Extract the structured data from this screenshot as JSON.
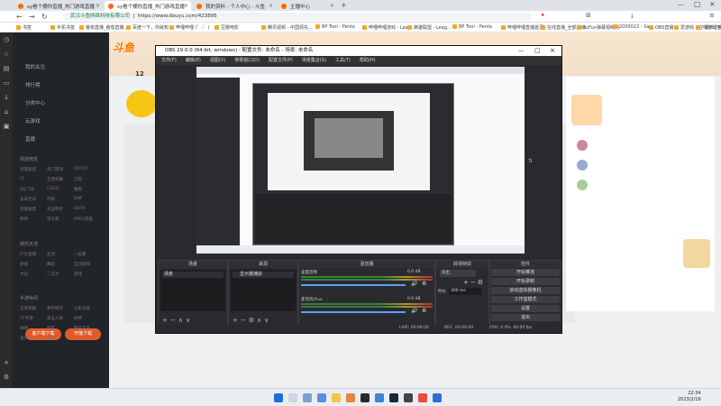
{
  "browser": {
    "tabs": [
      {
        "label": "sy看个棚你直播_热门游戏直播"
      },
      {
        "label": "sy看个棚你直播_热门游戏直播"
      },
      {
        "label": "我的资料 - 个人中心 - 斗鱼"
      },
      {
        "label": "主播中心"
      }
    ],
    "url_secure": "武汉斗鱼网络科技有限公司",
    "url": "https://www.douyu.com/423895",
    "bookmarks": [
      "书签",
      "手机书签",
      "番茄直播_番茄直播...",
      "百度一下，你就知",
      "哔哩哔哩 (゜-゜)",
      "豆瓣电影",
      "腾讯视频 - 中国领先...",
      "BP Tool - Penta",
      "哔哩哔哩游戏 - Leag...",
      "英雄联盟 - Leag...",
      "BP Tool - Penta",
      "哔哩哔哩直播首页",
      "在线直播_全部游戏...",
      "AcFun弹幕视频网",
      "2000022 - Sam...",
      "OBS直播",
      "爱游戏 - 在线游戏平台",
      "“娱乐之都”游戏平台"
    ]
  },
  "sidebar": {
    "top_items": [
      "我的关注",
      "排行榜",
      "分类中心",
      "云游戏"
    ],
    "live_label": "直播",
    "sections": [
      {
        "title": "网游竞技",
        "items": [
          "英雄联盟",
          "热门游戏",
          "DOTA2",
          "CF",
          "王者荣耀",
          "刀塔",
          "QQ飞车",
          "CSGO",
          "魔兽",
          "永劫无间",
          "传奇",
          "DNF",
          "英雄联盟",
          "天涯明月",
          "DOTA",
          "原神",
          "逆水寒",
          "APEX英雄"
        ]
      },
      {
        "title": "娱乐天地",
        "items": [
          "户外直播",
          "生活",
          "一起看",
          "颜值",
          "舞蹈",
          "互动游戏",
          "文化",
          "二次元",
          "游戏"
        ]
      },
      {
        "title": "手游休闲",
        "items": [
          "王者荣耀",
          "和平精英",
          "火影忍者",
          "CF手游",
          "第五人格",
          "原神",
          "球球",
          "暗区",
          "明日方舟",
          "蛋仔派对",
          "更多"
        ]
      }
    ],
    "btn_left": "客户端下载",
    "btn_right": "开播下载"
  },
  "page": {
    "logo": "斗鱼",
    "count": "12"
  },
  "obs": {
    "title": "OBS 29.0.0 (64-bit, windows) - 配置文件: 未命名 - 场景: 未命名",
    "menu": [
      "文件(F)",
      "编辑(E)",
      "视图(V)",
      "停靠窗口(D)",
      "配置文件(P)",
      "场景集合(S)",
      "工具(T)",
      "帮助(H)"
    ],
    "docks": {
      "scenes": {
        "title": "场景",
        "item": "场景"
      },
      "sources": {
        "title": "来源",
        "item": "显示器捕获"
      },
      "mixer": {
        "title": "混音器",
        "ch1": "桌面音频",
        "ch2": "麦克风/Aux",
        "db1": "0.0 dB",
        "db2": "0.0 dB"
      },
      "transitions": {
        "title": "转场特效",
        "type": "淡出",
        "duration_label": "时长",
        "duration": "300 ms"
      },
      "controls": {
        "title": "控件",
        "buttons": [
          "开始推流",
          "开始录制",
          "启动虚拟摄像机",
          "工作室模式",
          "设置",
          "退出"
        ]
      }
    },
    "status": {
      "live": "LIVE: 00:00:00",
      "rec": "REC: 00:00:00",
      "cpu": "CPU: 0.4%, 60.00 fps"
    }
  },
  "taskbar": {
    "time": "22:34",
    "date": "2023/2/16"
  },
  "colors": {
    "accent": "#ff7a00",
    "obs_bg": "#2a2a2e",
    "sidebar_bg": "#212429"
  }
}
